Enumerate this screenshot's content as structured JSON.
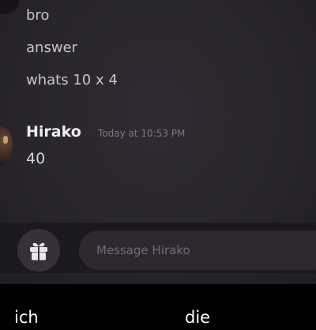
{
  "messages_prev": [
    "bro",
    "answer",
    "whats 10 x 4"
  ],
  "reply": {
    "author": "Hirako",
    "timestamp": "Today at 10:53 PM",
    "text": "40"
  },
  "composer": {
    "placeholder": "Message Hirako",
    "gift_icon": "gift-icon"
  },
  "caption": {
    "left": "ich",
    "right": "die"
  },
  "colors": {
    "chat_bg": "#29252c",
    "text": "#c9c5cc",
    "author": "#f2eff4",
    "timestamp": "#7c7781",
    "input_bg": "#2d2830"
  }
}
